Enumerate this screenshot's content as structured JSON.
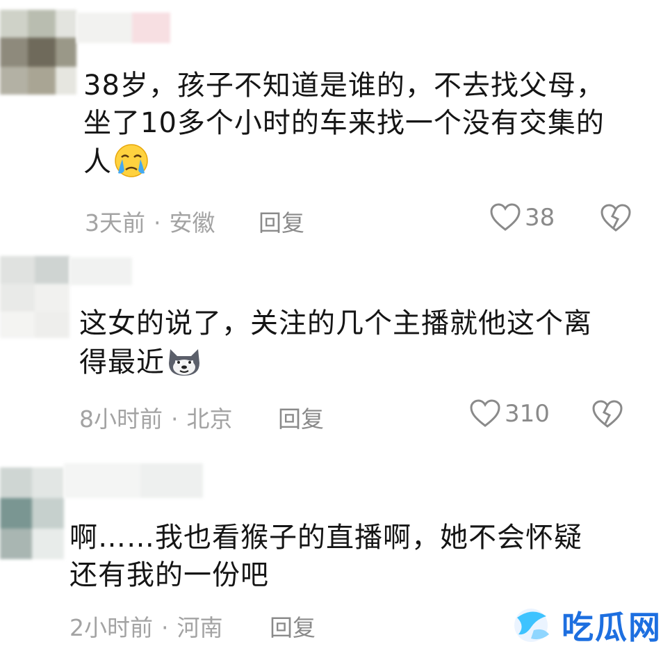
{
  "comments": [
    {
      "text_lines": [
        "38岁，孩子不知道是谁的，不去找父母，",
        "坐了10多个小时的车来找一个没有交集的",
        "人"
      ],
      "emoji": "crying-face-emoji",
      "time": "3天前",
      "location": "安徽",
      "separator": "·",
      "reply_label": "回复",
      "like_count": "38"
    },
    {
      "text_lines": [
        "这女的说了，关注的几个主播就他这个离",
        "得最近"
      ],
      "emoji": "doge-emoji",
      "time": "8小时前",
      "location": "北京",
      "separator": "·",
      "reply_label": "回复",
      "like_count": "310"
    },
    {
      "text_lines": [
        "啊……我也看猴子的直播啊，她不会怀疑",
        "还有我的一份吧"
      ],
      "time": "2小时前",
      "location": "河南",
      "separator": "·",
      "reply_label": "回复"
    }
  ],
  "watermark": {
    "text": "吃瓜网"
  },
  "colors": {
    "meta_text": "#a3a3a3",
    "action_text": "#8a8a8a",
    "watermark": "#1d6fe0"
  }
}
